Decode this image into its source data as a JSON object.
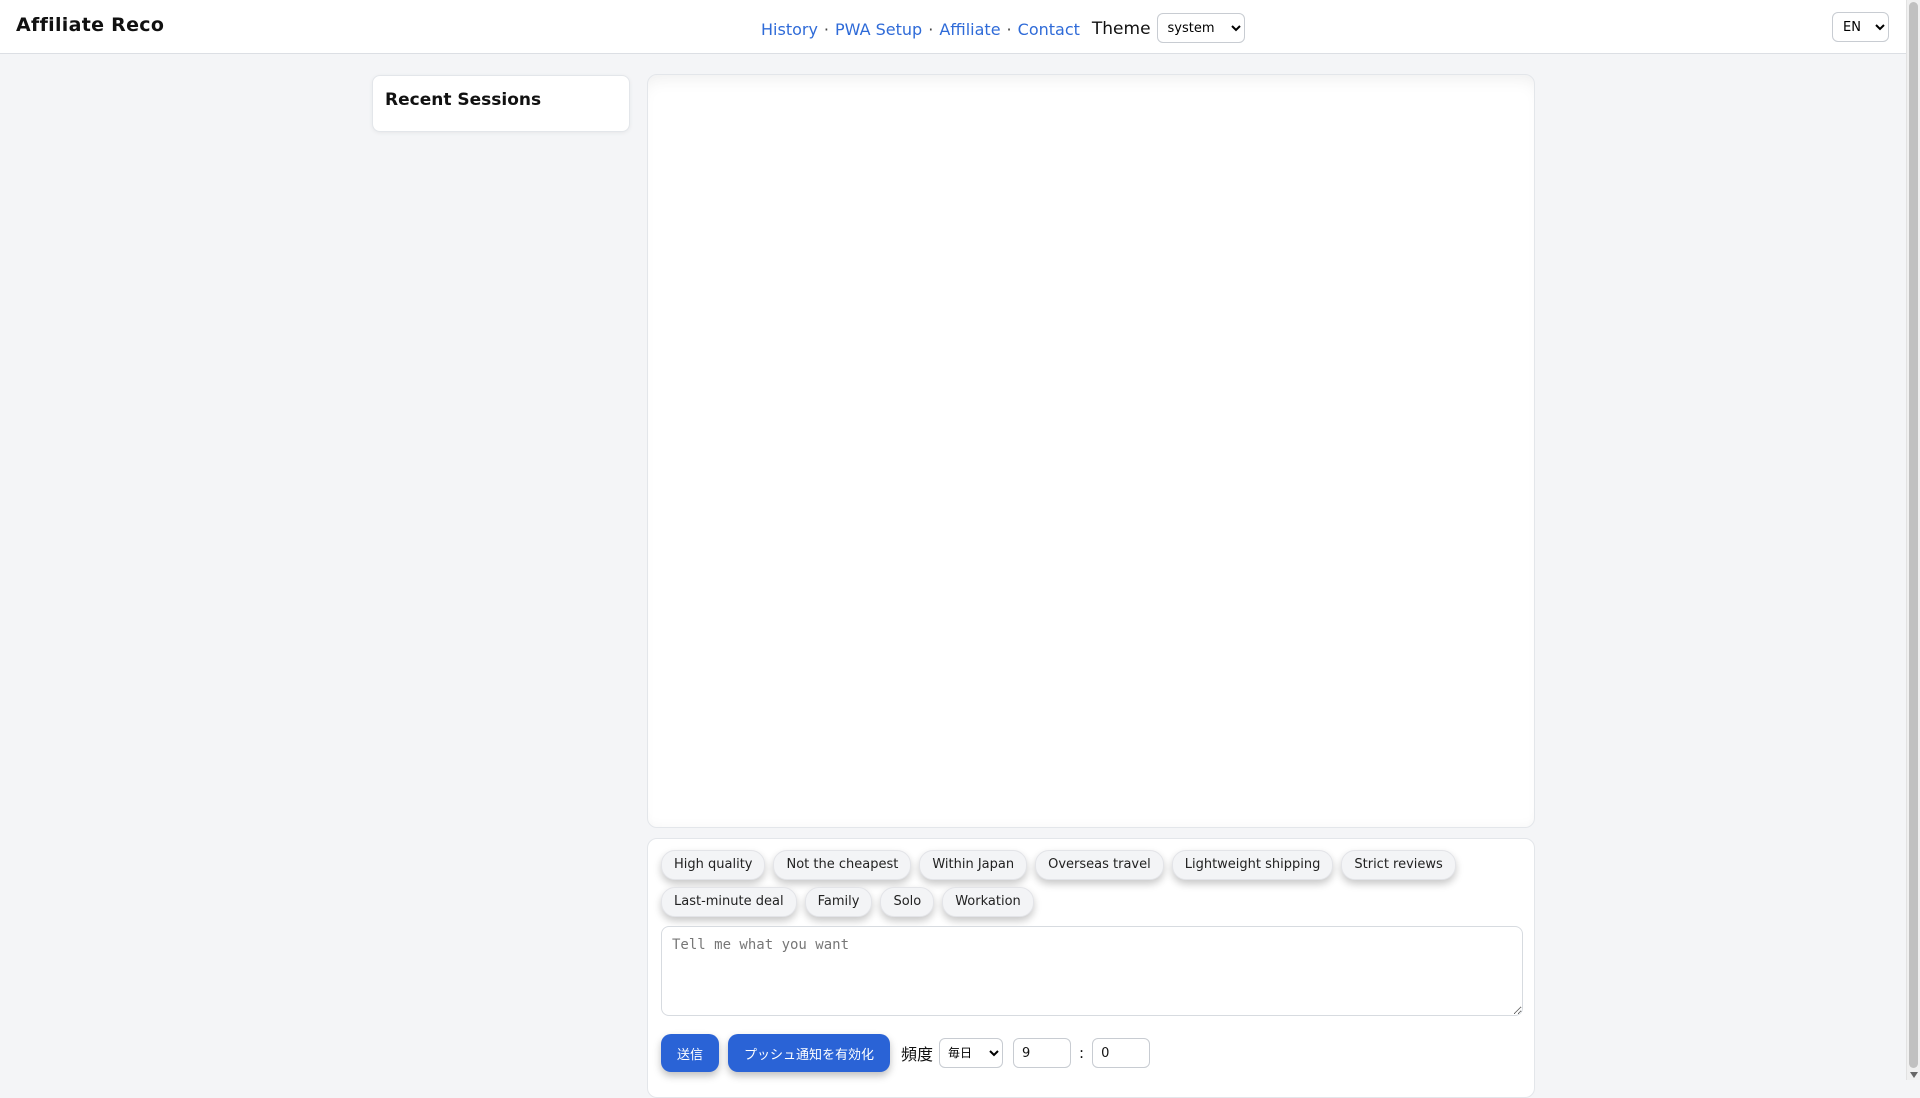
{
  "header": {
    "brand": "Affiliate Reco",
    "nav": [
      {
        "label": "History"
      },
      {
        "label": "PWA Setup"
      },
      {
        "label": "Affiliate"
      },
      {
        "label": "Contact"
      }
    ],
    "nav_separator": "·",
    "theme_label": "Theme",
    "theme_value": "system",
    "language_value": "EN"
  },
  "sidebar": {
    "title": "Recent Sessions"
  },
  "composer": {
    "chips_row1": [
      "High quality",
      "Not the cheapest",
      "Within Japan",
      "Overseas travel",
      "Lightweight shipping",
      "Strict reviews"
    ],
    "chips_row2": [
      "Last-minute deal",
      "Family",
      "Solo",
      "Workation"
    ],
    "input_placeholder": "Tell me what you want",
    "send_label": "送信",
    "push_label": "プッシュ通知を有効化",
    "frequency_label": "頻度",
    "frequency_value": "毎日",
    "hour_value": "9",
    "time_separator": ":",
    "minute_value": "0"
  },
  "colors": {
    "accent": "#2a63d6",
    "link": "#2f6bd8",
    "background": "#f4f5f7"
  }
}
